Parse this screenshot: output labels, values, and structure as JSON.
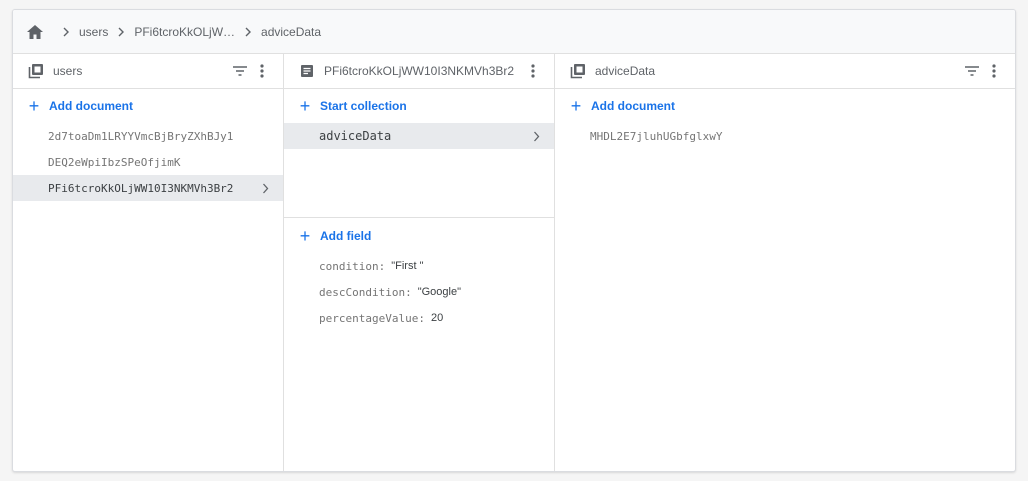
{
  "breadcrumb": {
    "items": [
      "users",
      "PFi6tcroKkOLjW…",
      "adviceData"
    ]
  },
  "columns": {
    "users": {
      "title": "users",
      "action": "Add document",
      "docs": [
        "2d7toaDm1LRYYVmcBjBryZXhBJy1",
        "DEQ2eWpiIbzSPeOfjimK",
        "PFi6tcroKkOLjWW10I3NKMVh3Br2"
      ]
    },
    "document": {
      "title": "PFi6tcroKkOLjWW10I3NKMVh3Br2",
      "collection_action": "Start collection",
      "collections": [
        "adviceData"
      ],
      "field_action": "Add field",
      "fields": [
        {
          "key": "condition:",
          "value": "\"First \""
        },
        {
          "key": "descCondition:",
          "value": "\"Google\""
        },
        {
          "key": "percentageValue:",
          "value": "20"
        }
      ]
    },
    "advice": {
      "title": "adviceData",
      "action": "Add document",
      "docs": [
        "MHDL2E7jluhUGbfglxwY"
      ]
    }
  },
  "colors": {
    "accent": "#1a73e8",
    "selected_bg": "#e8eaed",
    "border": "#e0e0e0"
  }
}
